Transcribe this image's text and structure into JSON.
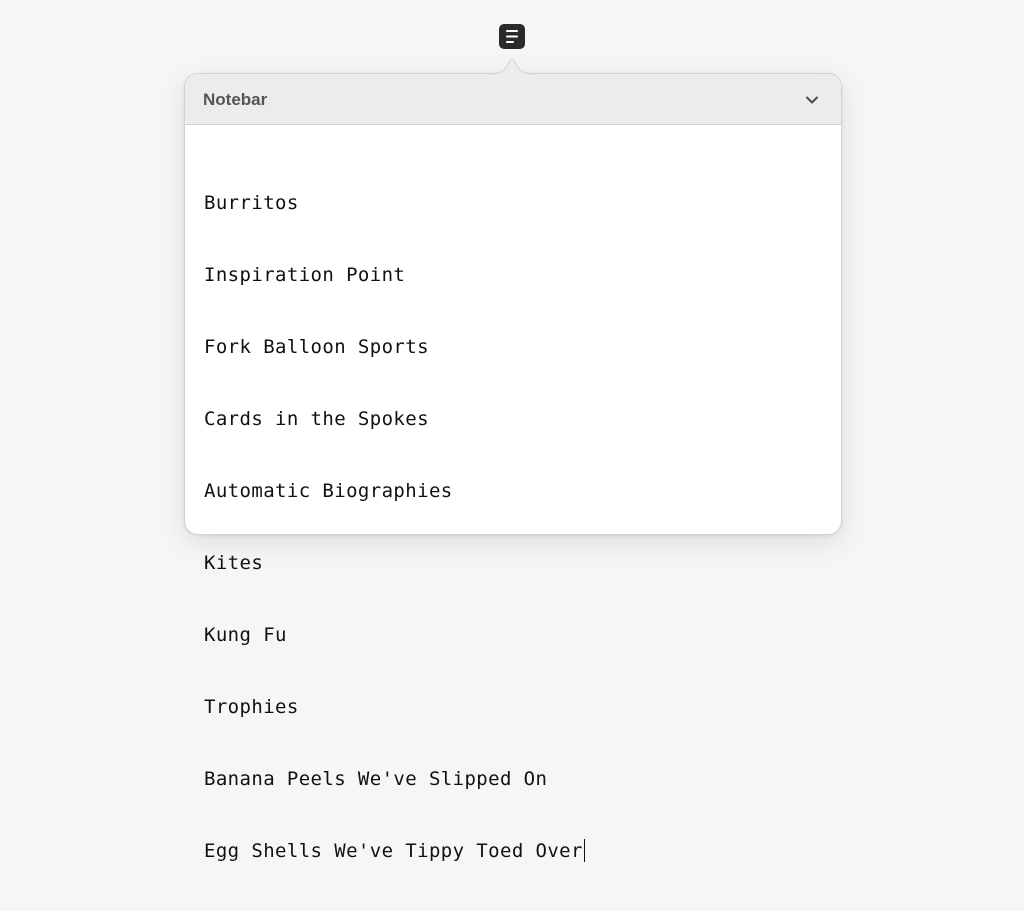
{
  "app": {
    "icon": "notes-list-icon"
  },
  "popover": {
    "title": "Notebar",
    "collapse_icon": "chevron-down-icon"
  },
  "note": {
    "lines": [
      "Burritos",
      "Inspiration Point",
      "Fork Balloon Sports",
      "Cards in the Spokes",
      "Automatic Biographies",
      "Kites",
      "Kung Fu",
      "Trophies",
      "Banana Peels We've Slipped On",
      "Egg Shells We've Tippy Toed Over"
    ]
  },
  "colors": {
    "background": "#f6f6f6",
    "header": "#ececec",
    "icon": "#2a2a2a"
  }
}
